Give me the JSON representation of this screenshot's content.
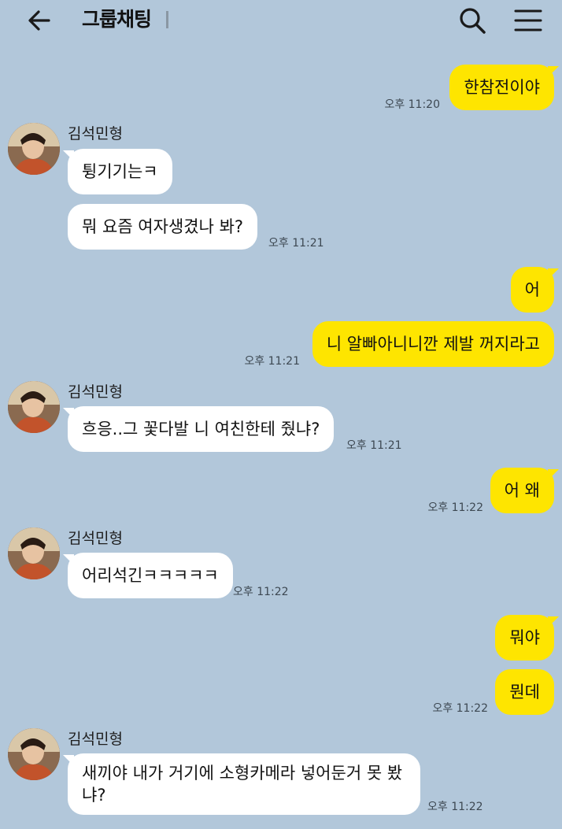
{
  "header": {
    "title": "그룹채팅"
  },
  "messages": [
    {
      "side": "me",
      "text": "한참전이야",
      "time": "오후 11:20"
    },
    {
      "side": "other",
      "sender": "김석민형",
      "text": "튕기기는ㅋ"
    },
    {
      "side": "other",
      "text": "뭐 요즘 여자생겼나 봐?",
      "time": "오후 11:21"
    },
    {
      "side": "me",
      "text": "어"
    },
    {
      "side": "me",
      "text": "니 알빠아니니깐 제발 꺼지라고",
      "time": "오후 11:21"
    },
    {
      "side": "other",
      "sender": "김석민형",
      "text": "흐응..그 꽃다발 니 여친한테 줬냐?",
      "time": "오후 11:21"
    },
    {
      "side": "me",
      "text": "어 왜",
      "time": "오후 11:22"
    },
    {
      "side": "other",
      "sender": "김석민형",
      "text": "어리석긴ㅋㅋㅋㅋㅋ",
      "time": "오후 11:22"
    },
    {
      "side": "me",
      "text": "뭐야"
    },
    {
      "side": "me",
      "text": "뭔데",
      "time": "오후 11:22"
    },
    {
      "side": "other",
      "sender": "김석민형",
      "text": "새끼야 내가 거기에 소형카메라 넣어둔거 못 봤냐?",
      "time": "오후 11:22"
    }
  ],
  "colors": {
    "background": "#b2c7da",
    "my_bubble": "#fee500",
    "other_bubble": "#ffffff"
  },
  "icons": {
    "back": "arrow-left-icon",
    "search": "search-icon",
    "menu": "hamburger-menu-icon"
  }
}
